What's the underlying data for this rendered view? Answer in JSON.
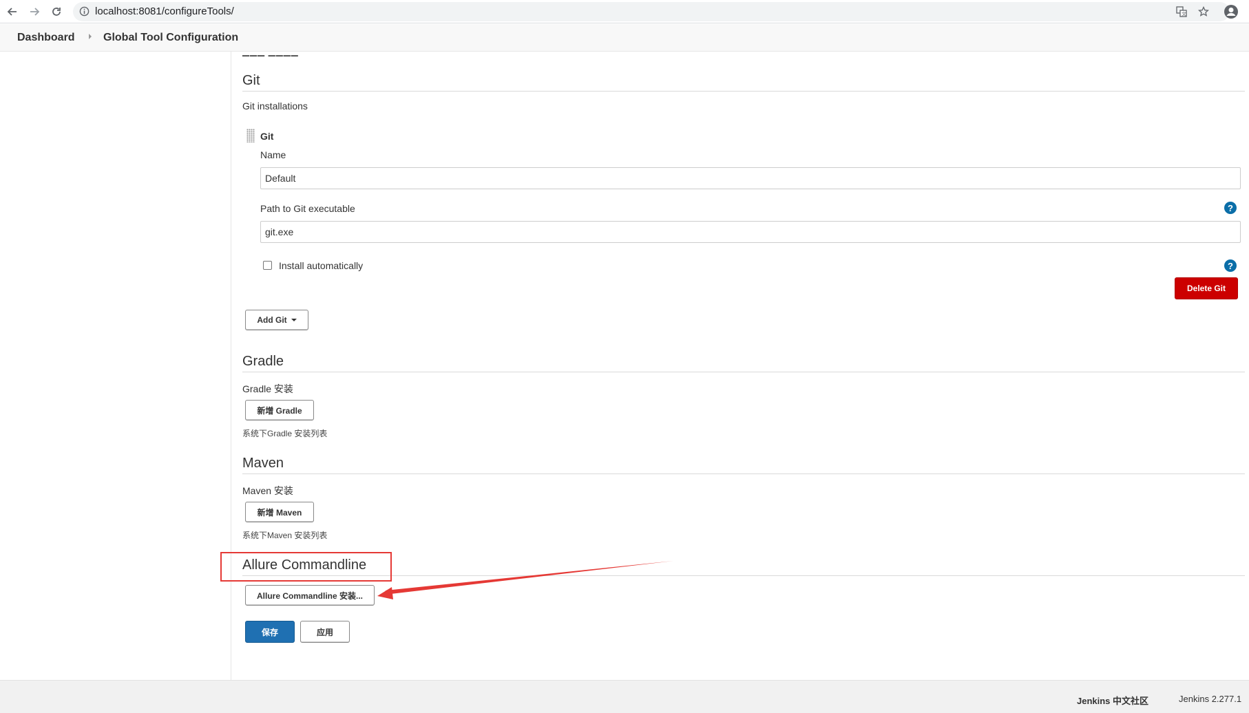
{
  "browser": {
    "url": "localhost:8081/configureTools/"
  },
  "breadcrumb": {
    "dashboard": "Dashboard",
    "current": "Global Tool Configuration"
  },
  "git": {
    "heading": "Git",
    "installations_label": "Git installations",
    "item_title": "Git",
    "name_label": "Name",
    "name_value": "Default",
    "path_label": "Path to Git executable",
    "path_value": "git.exe",
    "install_auto_label": "Install automatically",
    "install_auto_checked": false,
    "delete_button": "Delete Git",
    "add_button": "Add Git"
  },
  "gradle": {
    "heading": "Gradle",
    "install_label": "Gradle 安装",
    "add_button": "新增 Gradle",
    "description": "系统下Gradle 安装列表"
  },
  "maven": {
    "heading": "Maven",
    "install_label": "Maven 安装",
    "add_button": "新增 Maven",
    "description": "系统下Maven 安装列表"
  },
  "allure": {
    "heading": "Allure Commandline",
    "install_button": "Allure Commandline 安装..."
  },
  "actions": {
    "save": "保存",
    "apply": "应用"
  },
  "help_glyph": "?",
  "footer": {
    "community": "Jenkins 中文社区",
    "version": "Jenkins 2.277.1"
  },
  "colors": {
    "delete_red": "#cc0000",
    "save_blue": "#1f70b2",
    "help_blue": "#0b6ea8",
    "annotation_red": "#e53935"
  },
  "icons": [
    "back-arrow-icon",
    "forward-arrow-icon",
    "reload-icon",
    "info-icon",
    "translate-icon",
    "star-icon",
    "profile-icon",
    "help-icon",
    "caret-down-icon",
    "drag-handle-icon"
  ]
}
